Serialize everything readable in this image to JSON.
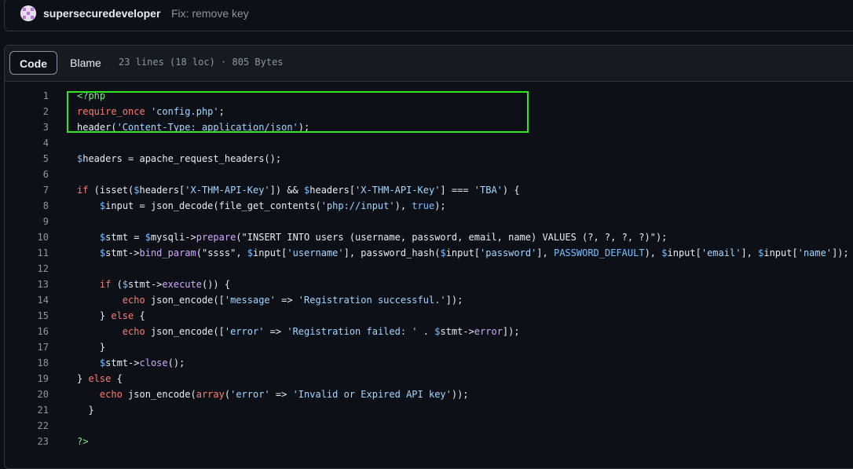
{
  "commit": {
    "author": "supersecuredeveloper",
    "message": "Fix: remove key"
  },
  "file_header": {
    "tabs": [
      {
        "label": "Code",
        "active": true
      },
      {
        "label": "Blame",
        "active": false
      }
    ],
    "meta": "23 lines (18 loc) · 805 Bytes"
  },
  "colors": {
    "keyword": "#ff7b72",
    "string": "#a5d6ff",
    "variable": "#79c0ff",
    "function": "#d2a8ff",
    "tag": "#7ee787",
    "highlight_box": "#2ee621"
  },
  "code_lines": [
    {
      "n": "1",
      "tokens": [
        [
          "tag",
          "<?php"
        ]
      ]
    },
    {
      "n": "2",
      "tokens": [
        [
          "kw",
          "require_once"
        ],
        [
          "plain",
          " "
        ],
        [
          "str",
          "'config.php'"
        ],
        [
          "plain",
          ";"
        ]
      ]
    },
    {
      "n": "3",
      "tokens": [
        [
          "plain",
          "header("
        ],
        [
          "str",
          "'Content-Type: application/json'"
        ],
        [
          "plain",
          ");"
        ]
      ]
    },
    {
      "n": "4",
      "tokens": []
    },
    {
      "n": "5",
      "tokens": [
        [
          "var",
          "$"
        ],
        [
          "plain",
          "headers = apache_request_headers();"
        ]
      ]
    },
    {
      "n": "6",
      "tokens": []
    },
    {
      "n": "7",
      "tokens": [
        [
          "kw",
          "if"
        ],
        [
          "plain",
          " (isset("
        ],
        [
          "var",
          "$"
        ],
        [
          "plain",
          "headers["
        ],
        [
          "str",
          "'X-THM-API-Key'"
        ],
        [
          "plain",
          "]) && "
        ],
        [
          "var",
          "$"
        ],
        [
          "plain",
          "headers["
        ],
        [
          "str",
          "'X-THM-API-Key'"
        ],
        [
          "plain",
          "] === "
        ],
        [
          "str",
          "'TBA'"
        ],
        [
          "plain",
          ") {"
        ]
      ]
    },
    {
      "n": "8",
      "tokens": [
        [
          "plain",
          "    "
        ],
        [
          "var",
          "$"
        ],
        [
          "plain",
          "input = json_decode(file_get_contents("
        ],
        [
          "str",
          "'php://input'"
        ],
        [
          "plain",
          "), "
        ],
        [
          "var",
          "true"
        ],
        [
          "plain",
          ");"
        ]
      ]
    },
    {
      "n": "9",
      "tokens": []
    },
    {
      "n": "10",
      "tokens": [
        [
          "plain",
          "    "
        ],
        [
          "var",
          "$"
        ],
        [
          "plain",
          "stmt = "
        ],
        [
          "var",
          "$"
        ],
        [
          "plain",
          "mysqli->"
        ],
        [
          "fn",
          "prepare"
        ],
        [
          "plain",
          "(\"INSERT INTO users (username, password, email, name) VALUES (?, ?, ?, ?)\");"
        ]
      ]
    },
    {
      "n": "11",
      "tokens": [
        [
          "plain",
          "    "
        ],
        [
          "var",
          "$"
        ],
        [
          "plain",
          "stmt->"
        ],
        [
          "fn",
          "bind_param"
        ],
        [
          "plain",
          "(\"ssss\", "
        ],
        [
          "var",
          "$"
        ],
        [
          "plain",
          "input["
        ],
        [
          "str",
          "'username'"
        ],
        [
          "plain",
          "], password_hash("
        ],
        [
          "var",
          "$"
        ],
        [
          "plain",
          "input["
        ],
        [
          "str",
          "'password'"
        ],
        [
          "plain",
          "], "
        ],
        [
          "var",
          "PASSWORD_DEFAULT"
        ],
        [
          "plain",
          "), "
        ],
        [
          "var",
          "$"
        ],
        [
          "plain",
          "input["
        ],
        [
          "str",
          "'email'"
        ],
        [
          "plain",
          "], "
        ],
        [
          "var",
          "$"
        ],
        [
          "plain",
          "input["
        ],
        [
          "str",
          "'name'"
        ],
        [
          "plain",
          "]);"
        ]
      ]
    },
    {
      "n": "12",
      "tokens": []
    },
    {
      "n": "13",
      "tokens": [
        [
          "plain",
          "    "
        ],
        [
          "kw",
          "if"
        ],
        [
          "plain",
          " ("
        ],
        [
          "var",
          "$"
        ],
        [
          "plain",
          "stmt->"
        ],
        [
          "fn",
          "execute"
        ],
        [
          "plain",
          "()) {"
        ]
      ]
    },
    {
      "n": "14",
      "tokens": [
        [
          "plain",
          "        "
        ],
        [
          "kw",
          "echo"
        ],
        [
          "plain",
          " json_encode(["
        ],
        [
          "str",
          "'message'"
        ],
        [
          "plain",
          " => "
        ],
        [
          "str",
          "'Registration successful.'"
        ],
        [
          "plain",
          "]);"
        ]
      ]
    },
    {
      "n": "15",
      "tokens": [
        [
          "plain",
          "    } "
        ],
        [
          "kw",
          "else"
        ],
        [
          "plain",
          " {"
        ]
      ]
    },
    {
      "n": "16",
      "tokens": [
        [
          "plain",
          "        "
        ],
        [
          "kw",
          "echo"
        ],
        [
          "plain",
          " json_encode(["
        ],
        [
          "str",
          "'error'"
        ],
        [
          "plain",
          " => "
        ],
        [
          "str",
          "'Registration failed: '"
        ],
        [
          "plain",
          " . "
        ],
        [
          "var",
          "$"
        ],
        [
          "plain",
          "stmt->"
        ],
        [
          "fn",
          "error"
        ],
        [
          "plain",
          "]);"
        ]
      ]
    },
    {
      "n": "17",
      "tokens": [
        [
          "plain",
          "    }"
        ]
      ]
    },
    {
      "n": "18",
      "tokens": [
        [
          "plain",
          "    "
        ],
        [
          "var",
          "$"
        ],
        [
          "plain",
          "stmt->"
        ],
        [
          "fn",
          "close"
        ],
        [
          "plain",
          "();"
        ]
      ]
    },
    {
      "n": "19",
      "tokens": [
        [
          "plain",
          "} "
        ],
        [
          "kw",
          "else"
        ],
        [
          "plain",
          " {"
        ]
      ]
    },
    {
      "n": "20",
      "tokens": [
        [
          "plain",
          "    "
        ],
        [
          "kw",
          "echo"
        ],
        [
          "plain",
          " json_encode("
        ],
        [
          "kw",
          "array"
        ],
        [
          "plain",
          "("
        ],
        [
          "str",
          "'error'"
        ],
        [
          "plain",
          " => "
        ],
        [
          "str",
          "'Invalid or Expired API key'"
        ],
        [
          "plain",
          "));"
        ]
      ]
    },
    {
      "n": "21",
      "tokens": [
        [
          "plain",
          "  }"
        ]
      ]
    },
    {
      "n": "22",
      "tokens": []
    },
    {
      "n": "23",
      "tokens": [
        [
          "tag",
          "?>"
        ]
      ]
    }
  ]
}
